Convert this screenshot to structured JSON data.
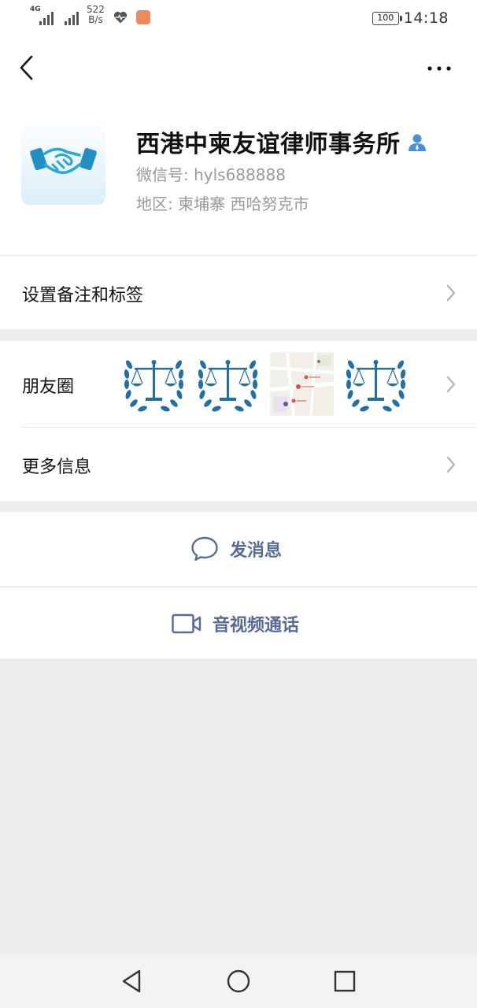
{
  "status_bar": {
    "network_type": "4G",
    "net_speed_value": "522",
    "net_speed_unit": "B/s",
    "battery": "100",
    "time": "14:18"
  },
  "nav": {
    "back_icon": "chevron-left-icon",
    "more_icon": "ellipsis-icon"
  },
  "profile": {
    "name": "西港中柬友谊律师事务所",
    "wechat_id": "微信号: hyls688888",
    "region": "地区: 柬埔寨  西哈努克市",
    "verified_icon": "person-icon"
  },
  "menu": {
    "remark_label": "设置备注和标签",
    "moments_label": "朋友圈",
    "more_info_label": "更多信息"
  },
  "actions": {
    "message_label": "发消息",
    "call_label": "音视频通话"
  },
  "colors": {
    "link": "#576b95",
    "background": "#ededed",
    "laurel_blue": "#1f6fa8"
  }
}
